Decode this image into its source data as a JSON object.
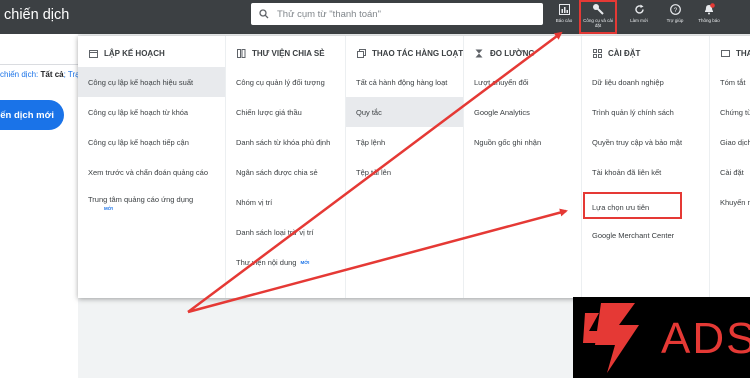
{
  "app": {
    "title": "chiến dịch"
  },
  "search": {
    "placeholder": "Thử cụm từ \"thanh toán\""
  },
  "toolbar": {
    "reports": "Báo cáo",
    "tools": "Công cụ và cài đặt",
    "refresh": "Làm mới",
    "help": "Trợ giúp",
    "notifications": "Thông báo",
    "notif_count": "1"
  },
  "left": {
    "filter_prefix": "chiến dịch:",
    "filter_all": "Tất cả",
    "filter_suffix": "; Trạng",
    "new_campaign": "chiến dịch mới"
  },
  "menu": {
    "columns": [
      {
        "heading": "LẬP KẾ HOẠCH",
        "items": [
          "Công cụ lập kế hoạch hiệu suất",
          "Công cụ lập kế hoạch từ khóa",
          "Công cụ lập kế hoạch tiếp cận",
          "Xem trước và chẩn đoán quảng cáo",
          "Trung tâm quảng cáo ứng dụng"
        ],
        "badge": "MỚI"
      },
      {
        "heading": "THƯ VIỆN CHIA SẺ",
        "items": [
          "Công cụ quản lý đối tượng",
          "Chiến lược giá thầu",
          "Danh sách từ khóa phủ định",
          "Ngân sách được chia sẻ",
          "Nhóm vị trí",
          "Danh sách loại trừ vị trí",
          "Thư viện nội dung"
        ],
        "badge": "MỚI"
      },
      {
        "heading": "THAO TÁC HÀNG LOẠT",
        "items": [
          "Tất cả hành động hàng loạt",
          "Quy tắc",
          "Tập lệnh",
          "Tệp tải lên"
        ]
      },
      {
        "heading": "ĐO LƯỜNG",
        "items": [
          "Lượt chuyển đổi",
          "Google Analytics",
          "Nguồn gốc ghi nhận"
        ]
      },
      {
        "heading": "CÀI ĐẶT",
        "items": [
          "Dữ liệu doanh nghiệp",
          "Trình quản lý chính sách",
          "Quyền truy cập và bảo mật",
          "Tài khoản đã liên kết",
          "Lựa chọn ưu tiên",
          "Google Merchant Center"
        ]
      },
      {
        "heading": "THA",
        "items": [
          "Tóm tắt",
          "Chứng từ",
          "Giao dịch",
          "Cài đặt",
          "Khuyến mã"
        ]
      }
    ]
  },
  "logo": {
    "text": "ADS"
  },
  "colors": {
    "topbar": "#3c4043",
    "accent": "#1a73e8",
    "highlight": "#e53935"
  }
}
